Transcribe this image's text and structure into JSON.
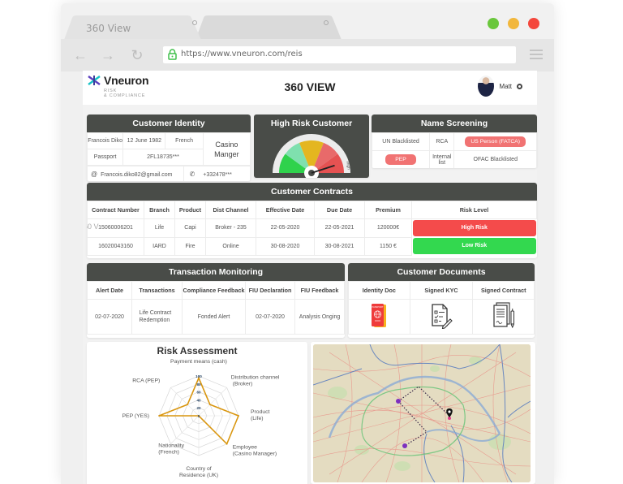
{
  "browser": {
    "tabs": [
      {
        "label": "360 View",
        "active": true
      },
      {
        "label": "",
        "active": false
      }
    ],
    "url": "https://www.vneuron.com/reis",
    "window_controls": {
      "colors": [
        "#6ac73c",
        "#f2b73c",
        "#f4473c"
      ]
    }
  },
  "header": {
    "logo_name": "Vneuron",
    "logo_sub_1": "RISK",
    "logo_sub_2": "& COMPLIANCE",
    "title": "360 VIEW",
    "user_name": "Matt"
  },
  "customer_identity": {
    "title": "Customer Identity",
    "name": "Francois Diko",
    "birth_date": "12 June 1982",
    "nationality": "French",
    "occupation": "Casino Manger",
    "doc_type": "Passport",
    "doc_number": "2FL18735***",
    "email": "Francois.diko82@gmail.com",
    "phone": "+332478***"
  },
  "high_risk": {
    "title": "High Risk Customer",
    "gauge_label": "High",
    "gauge_level": 0.9,
    "segment_colors": [
      "#2fd24c",
      "#7fe0ae",
      "#e4b620",
      "#e86a6a",
      "#e55252"
    ]
  },
  "name_screening": {
    "title": "Name Screening",
    "rows": [
      [
        {
          "text": "UN Blacklisted",
          "flag": false
        },
        {
          "text": "RCA",
          "flag": false
        },
        {
          "text": "US Person (FATCA)",
          "flag": true
        }
      ],
      [
        {
          "text": "PEP",
          "flag": true
        },
        {
          "text": "Internal list",
          "flag": false
        },
        {
          "text": "OFAC Blacklisted",
          "flag": false
        }
      ]
    ]
  },
  "contracts": {
    "title": "Customer Contracts",
    "columns": [
      "Contract Number",
      "Branch",
      "Product",
      "Dist Channel",
      "Effective Date",
      "Due Date",
      "Premium",
      "Risk Level"
    ],
    "overlay_text": "60 V",
    "rows": [
      {
        "number": "15060006201",
        "branch": "Life",
        "product": "Capi",
        "channel": "Broker - 235",
        "effective": "22-05-2020",
        "due": "22-05-2021",
        "premium": "120000€",
        "risk": "High Risk",
        "risk_level": "high"
      },
      {
        "number": "16020043160",
        "branch": "IARD",
        "product": "Fire",
        "channel": "Online",
        "effective": "30-08-2020",
        "due": "30-08-2021",
        "premium": "1150 €",
        "risk": "Low Risk",
        "risk_level": "low"
      }
    ],
    "risk_colors": {
      "high": "#f44b4b",
      "low": "#33d84f"
    }
  },
  "transactions": {
    "title": "Transaction Monitoring",
    "columns": [
      "Alert Date",
      "Transactions",
      "Compliance Feedback",
      "FIU Declaration",
      "FIU Feedback"
    ],
    "rows": [
      {
        "alert_date": "02-07-2020",
        "transaction": "Life Contract Redemption",
        "compliance": "Fonded Alert",
        "fiu_declaration": "02-07-2020",
        "fiu_feedback": "Analysis Onging"
      }
    ]
  },
  "documents": {
    "title": "Customer Documents",
    "columns": [
      "Identity Doc",
      "Signed KYC",
      "Signed Contract"
    ],
    "icons": [
      "passport-icon",
      "kyc-form-icon",
      "signed-contract-icon"
    ]
  },
  "chart_data": {
    "type": "radar",
    "title": "Risk Assessment",
    "categories": [
      "Payment means (cash)",
      "Distribution channel (Broker)",
      "Product (Life)",
      "Employee (Casino Manager)",
      "Country of Residence (UK)",
      "Nationality (French)",
      "PEP (YES)",
      "RCA (PEP)"
    ],
    "label_lines": [
      [
        "Payment means (cash)"
      ],
      [
        "Distribution channel",
        "(Broker)"
      ],
      [
        "Product",
        "(Life)"
      ],
      [
        "Employee",
        "(Casino Manager)"
      ],
      [
        "Country of",
        "Residence (UK)"
      ],
      [
        "Nationality",
        "(French)"
      ],
      [
        "PEP (YES)"
      ],
      [
        "RCA (PEP)"
      ]
    ],
    "series": [
      {
        "name": "Risk",
        "values": [
          95,
          40,
          100,
          100,
          0,
          0,
          100,
          40
        ],
        "color": "#d9960f"
      }
    ],
    "rlim": [
      0,
      100
    ],
    "rticks": [
      0,
      20,
      40,
      60,
      80,
      100
    ],
    "grid": true
  },
  "map": {
    "region": "Paris",
    "route_stops": 3,
    "route_color": "#6a2a8a"
  }
}
